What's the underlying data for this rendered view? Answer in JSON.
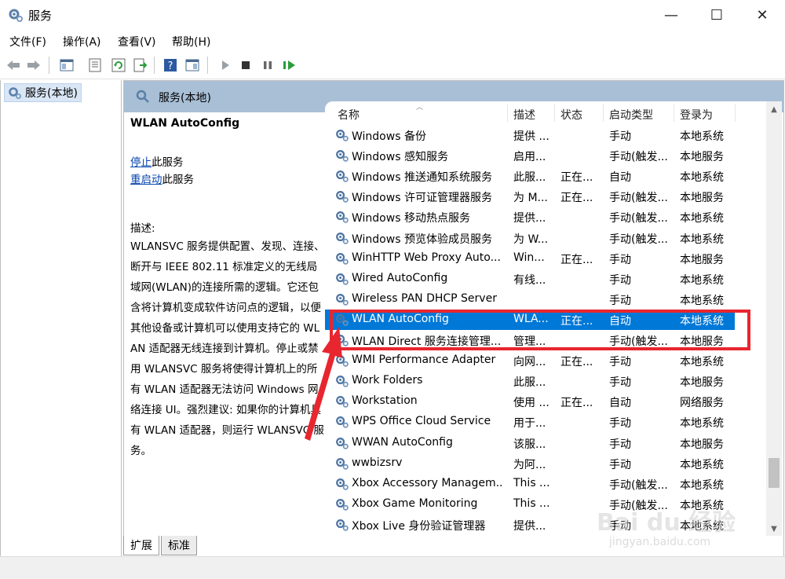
{
  "window": {
    "title": "服务",
    "minimize": "—",
    "maximize": "☐",
    "close": "✕"
  },
  "menu": [
    "文件(F)",
    "操作(A)",
    "查看(V)",
    "帮助(H)"
  ],
  "tree": {
    "root_label": "服务(本地)"
  },
  "panel": {
    "header": "服务(本地)"
  },
  "detail": {
    "service_title": "WLAN AutoConfig",
    "stop_link": "停止",
    "stop_suffix": "此服务",
    "restart_link": "重启动",
    "restart_suffix": "此服务",
    "desc_label": "描述:",
    "description": "WLANSVC 服务提供配置、发现、连接、断开与 IEEE 802.11 标准定义的无线局域网(WLAN)的连接所需的逻辑。它还包含将计算机变成软件访问点的逻辑，以便其他设备或计算机可以使用支持它的 WLAN 适配器无线连接到计算机。停止或禁用 WLANSVC 服务将使得计算机上的所有 WLAN 适配器无法访问 Windows 网络连接 UI。强烈建议: 如果你的计算机具有 WLAN 适配器，则运行 WLANSVC 服务。"
  },
  "columns": {
    "name": "名称",
    "description": "描述",
    "status": "状态",
    "startup": "启动类型",
    "logon": "登录为"
  },
  "services": [
    {
      "name": "Windows 备份",
      "desc": "提供 ...",
      "status": "",
      "startup": "手动",
      "logon": "本地系统"
    },
    {
      "name": "Windows 感知服务",
      "desc": "启用...",
      "status": "",
      "startup": "手动(触发...",
      "logon": "本地服务"
    },
    {
      "name": "Windows 推送通知系统服务",
      "desc": "此服...",
      "status": "正在...",
      "startup": "自动",
      "logon": "本地系统"
    },
    {
      "name": "Windows 许可证管理器服务",
      "desc": "为 M...",
      "status": "正在...",
      "startup": "手动(触发...",
      "logon": "本地服务"
    },
    {
      "name": "Windows 移动热点服务",
      "desc": "提供...",
      "status": "",
      "startup": "手动(触发...",
      "logon": "本地系统"
    },
    {
      "name": "Windows 预览体验成员服务",
      "desc": "为 W...",
      "status": "",
      "startup": "手动(触发...",
      "logon": "本地系统"
    },
    {
      "name": "WinHTTP Web Proxy Auto...",
      "desc": "Win...",
      "status": "正在...",
      "startup": "手动",
      "logon": "本地服务"
    },
    {
      "name": "Wired AutoConfig",
      "desc": "有线...",
      "status": "",
      "startup": "手动",
      "logon": "本地系统"
    },
    {
      "name": "Wireless PAN DHCP Server",
      "desc": "",
      "status": "",
      "startup": "手动",
      "logon": "本地系统"
    },
    {
      "name": "WLAN AutoConfig",
      "desc": "WLA...",
      "status": "正在...",
      "startup": "自动",
      "logon": "本地系统"
    },
    {
      "name": "WLAN Direct 服务连接管理...",
      "desc": "管理...",
      "status": "",
      "startup": "手动(触发...",
      "logon": "本地服务"
    },
    {
      "name": "WMI Performance Adapter",
      "desc": "向网...",
      "status": "正在...",
      "startup": "手动",
      "logon": "本地系统"
    },
    {
      "name": "Work Folders",
      "desc": "此服...",
      "status": "",
      "startup": "手动",
      "logon": "本地服务"
    },
    {
      "name": "Workstation",
      "desc": "使用 ...",
      "status": "正在...",
      "startup": "自动",
      "logon": "网络服务"
    },
    {
      "name": "WPS Office Cloud Service",
      "desc": "用于...",
      "status": "",
      "startup": "手动",
      "logon": "本地系统"
    },
    {
      "name": "WWAN AutoConfig",
      "desc": "该服...",
      "status": "",
      "startup": "手动",
      "logon": "本地服务"
    },
    {
      "name": "wwbizsrv",
      "desc": "为阿...",
      "status": "",
      "startup": "手动",
      "logon": "本地系统"
    },
    {
      "name": "Xbox Accessory Managem...",
      "desc": "This ...",
      "status": "",
      "startup": "手动(触发...",
      "logon": "本地系统"
    },
    {
      "name": "Xbox Game Monitoring",
      "desc": "This ...",
      "status": "",
      "startup": "手动(触发...",
      "logon": "本地系统"
    },
    {
      "name": "Xbox Live 身份验证管理器",
      "desc": "提供...",
      "status": "",
      "startup": "手动",
      "logon": "本地系统"
    }
  ],
  "selected_service": "WLAN AutoConfig",
  "tabs": [
    "扩展",
    "标准"
  ],
  "watermark": {
    "logo": "Bai du 经验",
    "url": "jingyan.baidu.com"
  },
  "colors": {
    "selection": "#0078d7",
    "panel_header": "#a8bfd6",
    "highlight": "#e8262f",
    "link": "#0645ad"
  }
}
